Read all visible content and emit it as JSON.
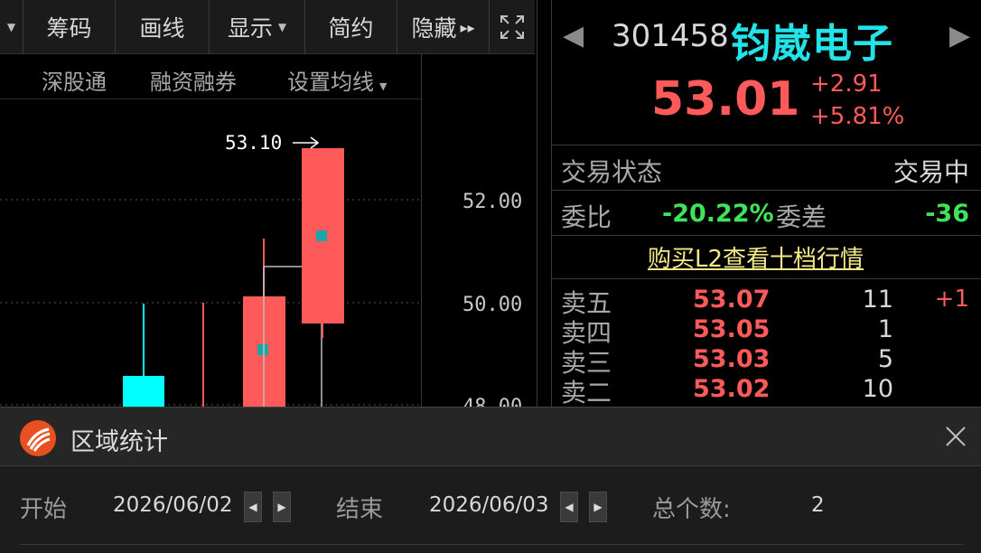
{
  "toolbar": {
    "items": [
      {
        "label": "",
        "has_caret": true
      },
      {
        "label": "筹码"
      },
      {
        "label": "画线"
      },
      {
        "label": "显示",
        "has_caret": true
      },
      {
        "label": "简约"
      },
      {
        "label": "隐藏"
      }
    ],
    "more_glyph": "▸▸",
    "fullscreen_icon": "fullscreen-icon"
  },
  "subbar": {
    "items": [
      "深股通",
      "融资融券",
      "设置均线"
    ]
  },
  "chart_data": {
    "type": "candlestick",
    "y_ticks": [
      "52.00",
      "50.00",
      "48.00"
    ],
    "high_annotation": "53.10",
    "colors": {
      "up": "#ff5a5a",
      "down": "#00ffff",
      "grid": "#555555",
      "marker": "#1aa7a7"
    }
  },
  "quote": {
    "code": "301458",
    "name": "钧崴电子",
    "price": "53.01",
    "change": "+2.91",
    "change_pct": "+5.81%",
    "status_label": "交易状态",
    "status_value": "交易中",
    "weibi_label": "委比",
    "weibi_value": "-20.22%",
    "weicha_label": "委差",
    "weicha_value": "-36",
    "l2_link": "购买L2查看十档行情",
    "orderbook": [
      {
        "label": "卖五",
        "price": "53.07",
        "volume": "11",
        "delta": "+1"
      },
      {
        "label": "卖四",
        "price": "53.05",
        "volume": "1",
        "delta": ""
      },
      {
        "label": "卖三",
        "price": "53.03",
        "volume": "5",
        "delta": ""
      },
      {
        "label": "卖二",
        "price": "53.02",
        "volume": "10",
        "delta": ""
      }
    ],
    "colors": {
      "up": "#ff5a5a",
      "down": "#3fe35a",
      "name": "#21e3e8"
    }
  },
  "dialog": {
    "title": "区域统计",
    "start_label": "开始",
    "start_value": "2026/06/02",
    "end_label": "结束",
    "end_value": "2026/06/03",
    "count_label": "总个数:",
    "count_value": "2"
  }
}
